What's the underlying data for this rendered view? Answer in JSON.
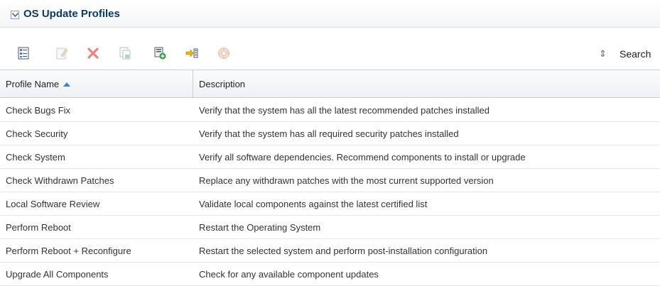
{
  "panel": {
    "title": "OS Update Profiles"
  },
  "toolbar": {
    "icons": [
      "create-profile-icon",
      "edit-profile-icon",
      "delete-icon",
      "copy-profile-icon",
      "add-profile-icon",
      "import-icon",
      "deploy-icon"
    ],
    "search_label": "Search",
    "sep_glyph": "⇕"
  },
  "table": {
    "columns": [
      "Profile Name",
      "Description"
    ],
    "sorted_column": "Profile Name",
    "sort_direction": "ascending",
    "rows": [
      {
        "name": "Check Bugs Fix",
        "description": "Verify that the system has all the latest recommended patches installed"
      },
      {
        "name": "Check Security",
        "description": "Verify that the system has all required security patches installed"
      },
      {
        "name": "Check System",
        "description": "Verify all software dependencies. Recommend components to install or upgrade"
      },
      {
        "name": "Check Withdrawn Patches",
        "description": "Replace any withdrawn patches with the most current supported version"
      },
      {
        "name": "Local Software Review",
        "description": "Validate local components against the latest certified list"
      },
      {
        "name": "Perform Reboot",
        "description": "Restart the Operating System"
      },
      {
        "name": "Perform Reboot + Reconfigure",
        "description": "Restart the selected system and perform post-installation configuration"
      },
      {
        "name": "Upgrade All Components",
        "description": "Check for any available component updates"
      }
    ]
  },
  "colors": {
    "title": "#0d3a66",
    "sort_arrow": "#3f7fc7",
    "delete_red": "#e0473c"
  }
}
